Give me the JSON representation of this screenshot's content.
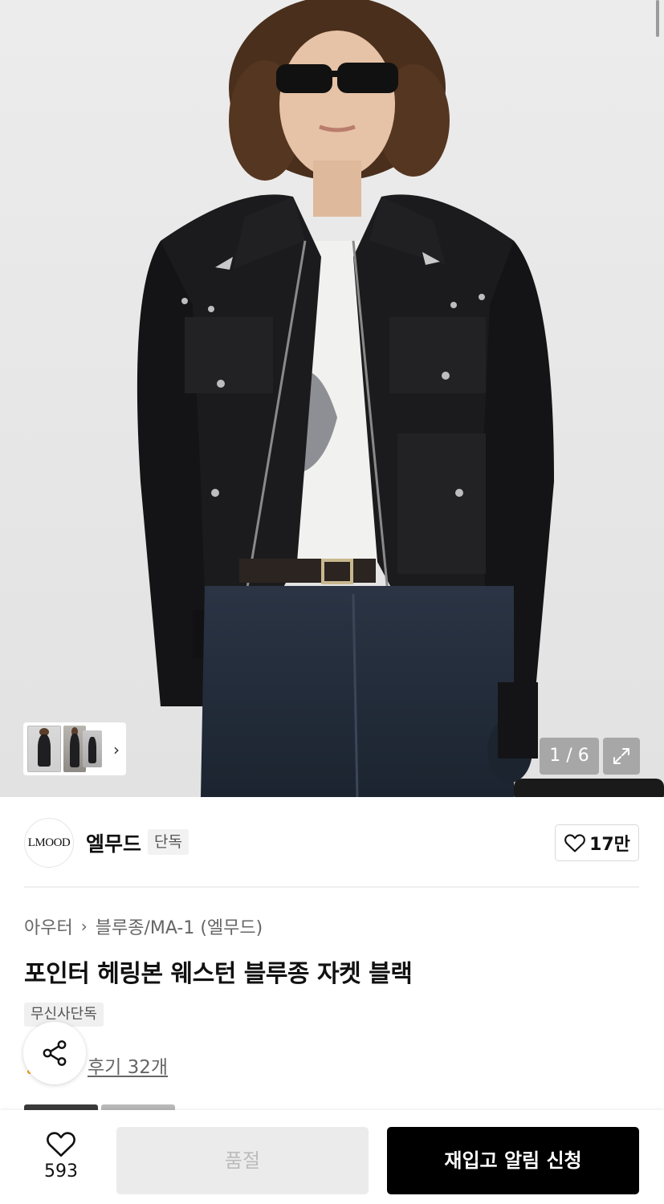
{
  "gallery": {
    "counter": "1 / 6",
    "thumbnail_count": 3
  },
  "brand": {
    "logo_text": "LMOOD",
    "name": "엘무드",
    "tag": "단독",
    "like_count": "17만"
  },
  "product": {
    "breadcrumb": [
      "아우터",
      "블루종/MA-1 (엘무드)"
    ],
    "title": "포인터 헤링본 웨스턴 블루종 자켓 블랙",
    "badge": "무신사단독",
    "review_link": "후기 32개"
  },
  "bottom_bar": {
    "wish_count": "593",
    "soldout_label": "품절",
    "restock_label": "재입고 알림 신청"
  },
  "colors": {
    "primary_button": "#000000",
    "disabled_button": "#ebebeb",
    "background": "#ffffff"
  }
}
